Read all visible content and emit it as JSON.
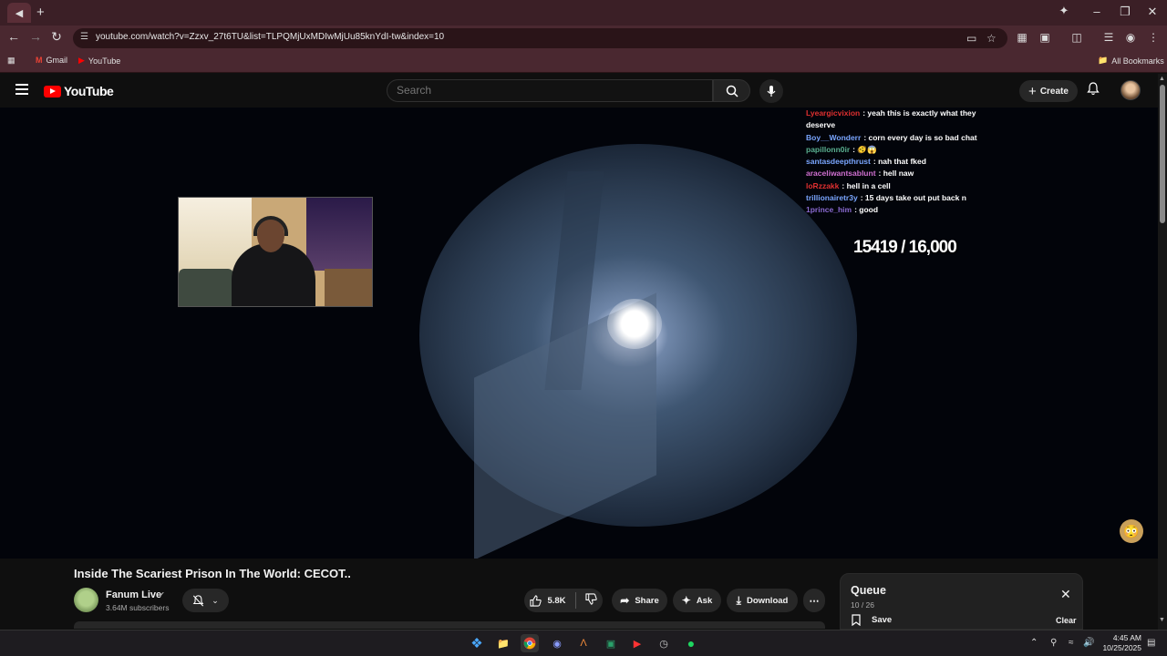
{
  "browser": {
    "tab_icon": "◀",
    "url": "youtube.com/watch?v=Zzxv_27t6TU&list=TLPQMjUxMDIwMjUu85knYdI-tw&index=10",
    "bookmarks": [
      {
        "label": "Gmail",
        "icon": "gmail-icon",
        "color": "#ea4335"
      },
      {
        "label": "YouTube",
        "icon": "youtube-icon",
        "color": "#ff0000"
      }
    ],
    "all_bookmarks": "All Bookmarks"
  },
  "youtube": {
    "logo_text": "YouTube",
    "search_placeholder": "Search",
    "create_label": "Create"
  },
  "video": {
    "chat": [
      {
        "user": "Lyeargicvixion",
        "text": "yeah this is exactly what they deserve",
        "color": "#e03030"
      },
      {
        "user": "Boy__Wonderr",
        "text": "corn every day is so bad chat",
        "color": "#7aa6ff"
      },
      {
        "user": "papillonn0ir",
        "text": "🫨😱",
        "color": "#5ab090"
      },
      {
        "user": "santasdeepthrust",
        "text": "nah that fked",
        "color": "#7aa6ff"
      },
      {
        "user": "araceliwantsablunt",
        "text": "hell naw",
        "color": "#d070d0"
      },
      {
        "user": "loRzzakk",
        "text": "hell in a cell",
        "color": "#e03030"
      },
      {
        "user": "trillionairetr3y",
        "text": "15 days take out put back n",
        "color": "#7aa6ff"
      },
      {
        "user": "1prince_him",
        "text": "good",
        "color": "#8a6ad0"
      }
    ],
    "counter": "15419 / 16,000"
  },
  "details": {
    "title": "Inside The Scariest Prison In The World: CECOT..",
    "channel": "Fanum Live",
    "subscribers": "3.64M subscribers",
    "likes": "5.8K",
    "share": "Share",
    "ask": "Ask",
    "download": "Download"
  },
  "queue": {
    "title": "Queue",
    "count": "10 / 26",
    "save": "Save",
    "clear": "Clear"
  },
  "taskbar": {
    "time": "4:45 AM",
    "date": "10/25/2025"
  }
}
